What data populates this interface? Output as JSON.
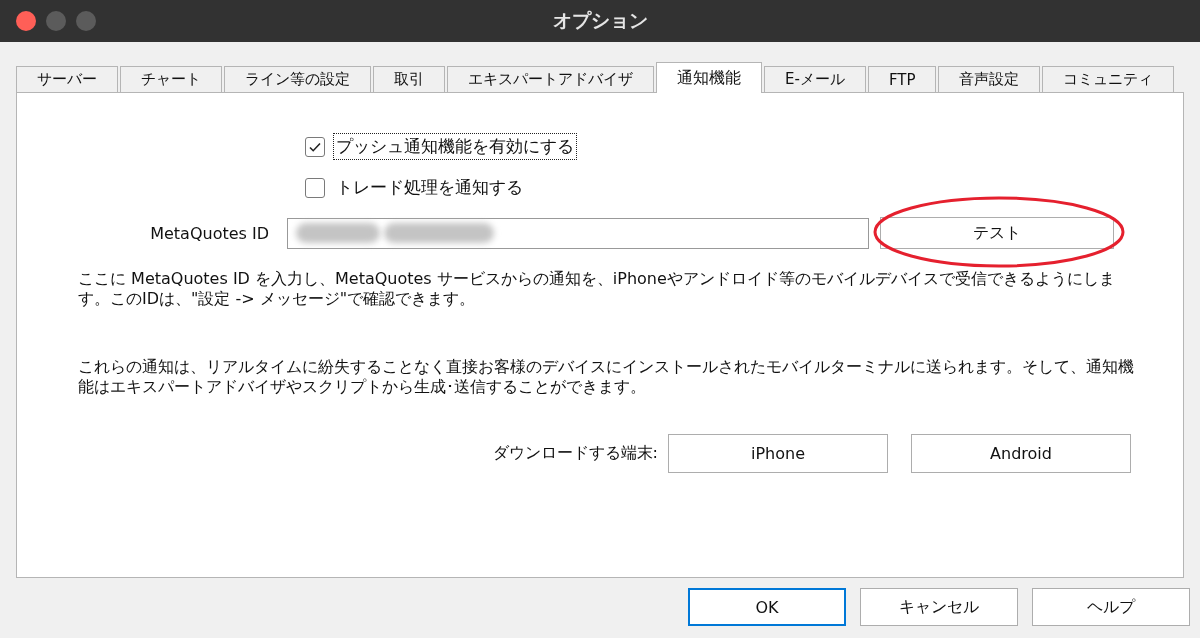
{
  "window": {
    "title": "オプション"
  },
  "tabs": [
    {
      "label": "サーバー",
      "selected": false
    },
    {
      "label": "チャート",
      "selected": false
    },
    {
      "label": "ライン等の設定",
      "selected": false
    },
    {
      "label": "取引",
      "selected": false
    },
    {
      "label": "エキスパートアドバイザ",
      "selected": false
    },
    {
      "label": "通知機能",
      "selected": true
    },
    {
      "label": "E-メール",
      "selected": false
    },
    {
      "label": "FTP",
      "selected": false
    },
    {
      "label": "音声設定",
      "selected": false
    },
    {
      "label": "コミュニティ",
      "selected": false
    }
  ],
  "checkboxes": [
    {
      "label": "プッシュ通知機能を有効にする",
      "checked": true,
      "focused": true
    },
    {
      "label": "トレード処理を通知する",
      "checked": false,
      "focused": false
    }
  ],
  "id_field": {
    "label": "MetaQuotes ID",
    "button": "テスト"
  },
  "paragraphs": [
    "ここに MetaQuotes ID を入力し、MetaQuotes サービスからの通知を、iPhoneやアンドロイド等のモバイルデバイスで受信できるようにします。このIDは、\"設定 -> メッセージ\"で確認できます。",
    "これらの通知は、リアルタイムに紛失することなく直接お客様のデバイスにインストールされたモバイルターミナルに送られます。そして、通知機能はエキスパートアドバイザやスクリプトから生成･送信することができます。"
  ],
  "download": {
    "label": "ダウンロードする端末:",
    "buttons": [
      "iPhone",
      "Android"
    ]
  },
  "footer_buttons": [
    {
      "label": "OK",
      "default": true
    },
    {
      "label": "キャンセル",
      "default": false
    },
    {
      "label": "ヘルプ",
      "default": false
    }
  ]
}
